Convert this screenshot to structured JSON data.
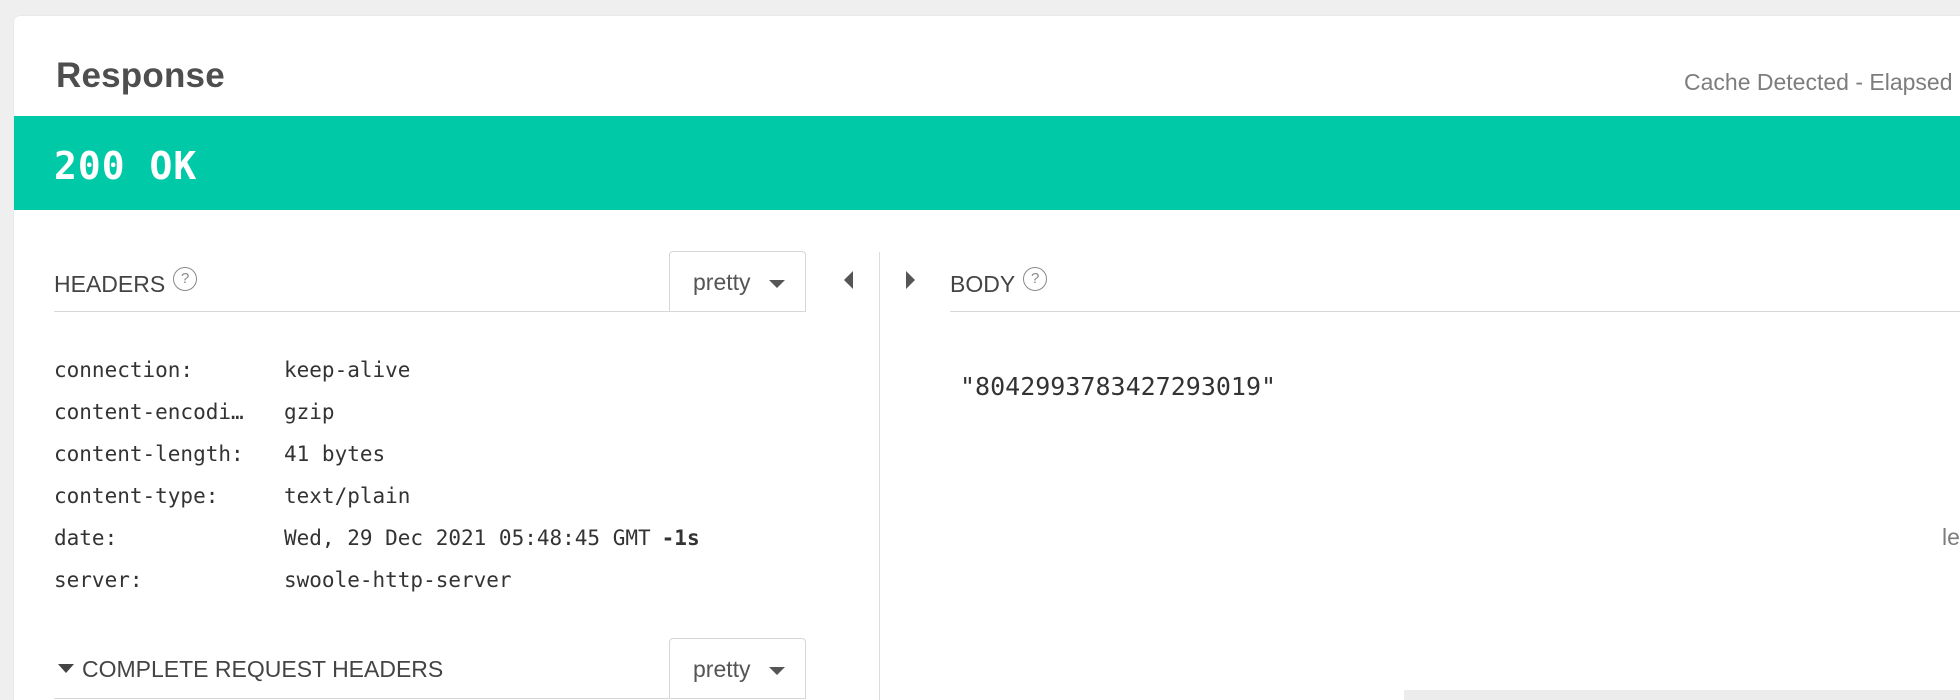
{
  "response": {
    "title": "Response",
    "meta": "Cache Detected - Elapsed",
    "status": "200 OK",
    "status_color": "#00c9a7"
  },
  "headers_panel": {
    "label": "HEADERS",
    "help_glyph": "?",
    "format": "pretty",
    "rows": [
      {
        "key": "connection:",
        "value": "keep-alive",
        "suffix": ""
      },
      {
        "key": "content-encodi…",
        "value": "gzip",
        "suffix": ""
      },
      {
        "key": "content-length:",
        "value": "41 bytes",
        "suffix": ""
      },
      {
        "key": "content-type:",
        "value": "text/plain",
        "suffix": ""
      },
      {
        "key": "date:",
        "value": "Wed, 29 Dec 2021 05:48:45 GMT",
        "suffix": "-1s"
      },
      {
        "key": "server:",
        "value": "swoole-http-server",
        "suffix": ""
      }
    ]
  },
  "body_panel": {
    "label": "BODY",
    "help_glyph": "?",
    "value": "\"8042993783427293019\"",
    "edge_text": "le"
  },
  "request_headers": {
    "label": "COMPLETE REQUEST HEADERS",
    "format": "pretty"
  },
  "icons": [
    "help-icon",
    "chevron-down-icon",
    "collapse-left-icon",
    "expand-right-icon",
    "caret-down-icon"
  ]
}
